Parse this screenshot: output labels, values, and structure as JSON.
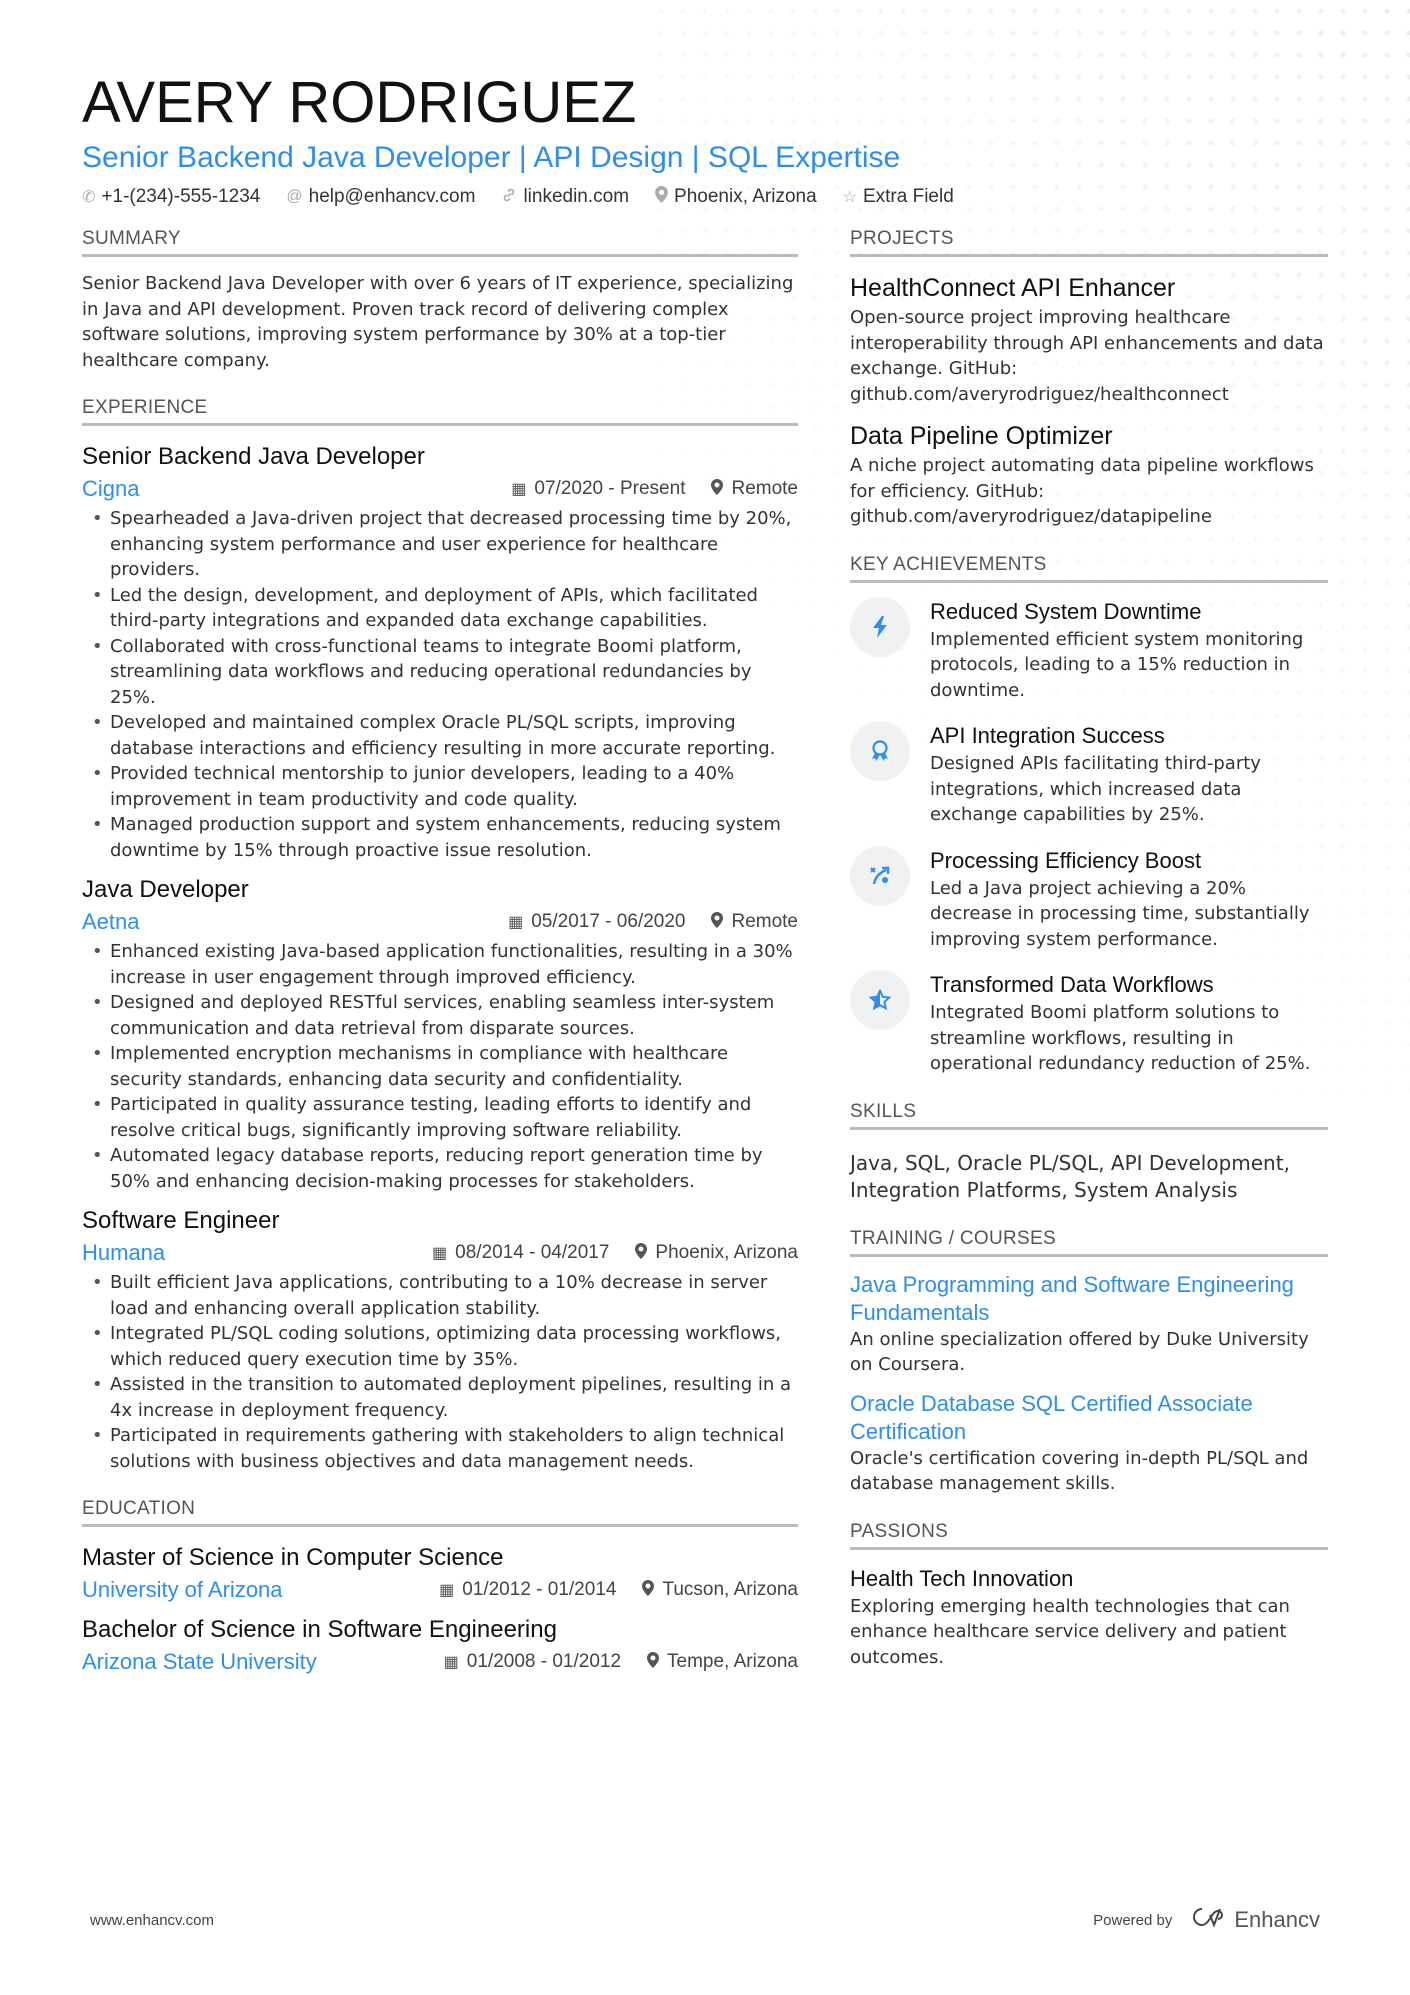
{
  "header": {
    "name": "AVERY RODRIGUEZ",
    "tagline": "Senior Backend Java Developer | API Design | SQL Expertise",
    "contacts": [
      {
        "icon": "phone-icon",
        "glyph": "✆",
        "text": "+1-(234)-555-1234"
      },
      {
        "icon": "at-icon",
        "glyph": "@",
        "text": "help@enhancv.com"
      },
      {
        "icon": "link-icon",
        "glyph": "🔗",
        "text": "linkedin.com"
      },
      {
        "icon": "location-icon",
        "glyph": "⚲",
        "text": "Phoenix, Arizona"
      },
      {
        "icon": "star-icon",
        "glyph": "☆",
        "text": "Extra Field"
      }
    ]
  },
  "summary": {
    "title": "SUMMARY",
    "text": "Senior Backend Java Developer with over 6 years of IT experience, specializing in Java and API development. Proven track record of delivering complex software solutions, improving system performance by 30% at a top-tier healthcare company."
  },
  "experience": {
    "title": "EXPERIENCE",
    "jobs": [
      {
        "title": "Senior Backend Java Developer",
        "company": "Cigna",
        "dates": "07/2020 - Present",
        "location": "Remote",
        "bullets": [
          "Spearheaded a Java-driven project that decreased processing time by 20%, enhancing system performance and user experience for healthcare providers.",
          "Led the design, development, and deployment of APIs, which facilitated third-party integrations and expanded data exchange capabilities.",
          "Collaborated with cross-functional teams to integrate Boomi platform, streamlining data workflows and reducing operational redundancies by 25%.",
          "Developed and maintained complex Oracle PL/SQL scripts, improving database interactions and efficiency resulting in more accurate reporting.",
          "Provided technical mentorship to junior developers, leading to a 40% improvement in team productivity and code quality.",
          "Managed production support and system enhancements, reducing system downtime by 15% through proactive issue resolution."
        ]
      },
      {
        "title": "Java Developer",
        "company": "Aetna",
        "dates": "05/2017 - 06/2020",
        "location": "Remote",
        "bullets": [
          "Enhanced existing Java-based application functionalities, resulting in a 30% increase in user engagement through improved efficiency.",
          "Designed and deployed RESTful services, enabling seamless inter-system communication and data retrieval from disparate sources.",
          "Implemented encryption mechanisms in compliance with healthcare security standards, enhancing data security and confidentiality.",
          "Participated in quality assurance testing, leading efforts to identify and resolve critical bugs, significantly improving software reliability.",
          "Automated legacy database reports, reducing report generation time by 50% and enhancing decision-making processes for stakeholders."
        ]
      },
      {
        "title": "Software Engineer",
        "company": "Humana",
        "dates": "08/2014 - 04/2017",
        "location": "Phoenix, Arizona",
        "bullets": [
          "Built efficient Java applications, contributing to a 10% decrease in server load and enhancing overall application stability.",
          "Integrated PL/SQL coding solutions, optimizing data processing workflows, which reduced query execution time by 35%.",
          "Assisted in the transition to automated deployment pipelines, resulting in a 4x increase in deployment frequency.",
          "Participated in requirements gathering with stakeholders to align technical solutions with business objectives and data management needs."
        ]
      }
    ]
  },
  "education": {
    "title": "EDUCATION",
    "items": [
      {
        "degree": "Master of Science in Computer Science",
        "school": "University of Arizona",
        "dates": "01/2012 - 01/2014",
        "location": "Tucson, Arizona"
      },
      {
        "degree": "Bachelor of Science in Software Engineering",
        "school": "Arizona State University",
        "dates": "01/2008 - 01/2012",
        "location": "Tempe, Arizona"
      }
    ]
  },
  "projects": {
    "title": "PROJECTS",
    "items": [
      {
        "title": "HealthConnect API Enhancer",
        "text": "Open-source project improving healthcare interoperability through API enhancements and data exchange. GitHub: github.com/averyrodriguez/healthconnect"
      },
      {
        "title": "Data Pipeline Optimizer",
        "text": "A niche project automating data pipeline workflows for efficiency. GitHub: github.com/averyrodriguez/datapipeline"
      }
    ]
  },
  "achievements": {
    "title": "KEY ACHIEVEMENTS",
    "items": [
      {
        "icon": "lightning-icon",
        "glyph": "ϟ",
        "title": "Reduced System Downtime",
        "text": "Implemented efficient system monitoring protocols, leading to a 15% reduction in downtime."
      },
      {
        "icon": "award-ribbon-icon",
        "glyph": "🎖",
        "title": "API Integration Success",
        "text": "Designed APIs facilitating third-party integrations, which increased data exchange capabilities by 25%."
      },
      {
        "icon": "strategy-arrow-icon",
        "glyph": "⤴",
        "title": "Processing Efficiency Boost",
        "text": "Led a Java project achieving a 20% decrease in processing time, substantially improving system performance."
      },
      {
        "icon": "star-half-icon",
        "glyph": "★",
        "title": "Transformed Data Workflows",
        "text": "Integrated Boomi platform solutions to streamline workflows, resulting in operational redundancy reduction of 25%."
      }
    ]
  },
  "skills": {
    "title": "SKILLS",
    "text": "Java, SQL, Oracle PL/SQL, API Development, Integration Platforms, System Analysis"
  },
  "training": {
    "title": "TRAINING / COURSES",
    "items": [
      {
        "title": "Java Programming and Software Engineering Fundamentals",
        "text": "An online specialization offered by Duke University on Coursera."
      },
      {
        "title": "Oracle Database SQL Certified Associate Certification",
        "text": "Oracle's certification covering in-depth PL/SQL and database management skills."
      }
    ]
  },
  "passions": {
    "title": "PASSIONS",
    "items": [
      {
        "title": "Health Tech Innovation",
        "text": "Exploring emerging health technologies that can enhance healthcare service delivery and patient outcomes."
      }
    ]
  },
  "footer": {
    "url": "www.enhancv.com",
    "powered_by": "Powered by",
    "brand": "Enhancv"
  },
  "icons": {
    "calendar": "▦",
    "location": "⚲"
  },
  "colors": {
    "accent": "#2d8eef",
    "text": "#333333",
    "heading": "#111111",
    "rule": "#bbbbbb"
  }
}
